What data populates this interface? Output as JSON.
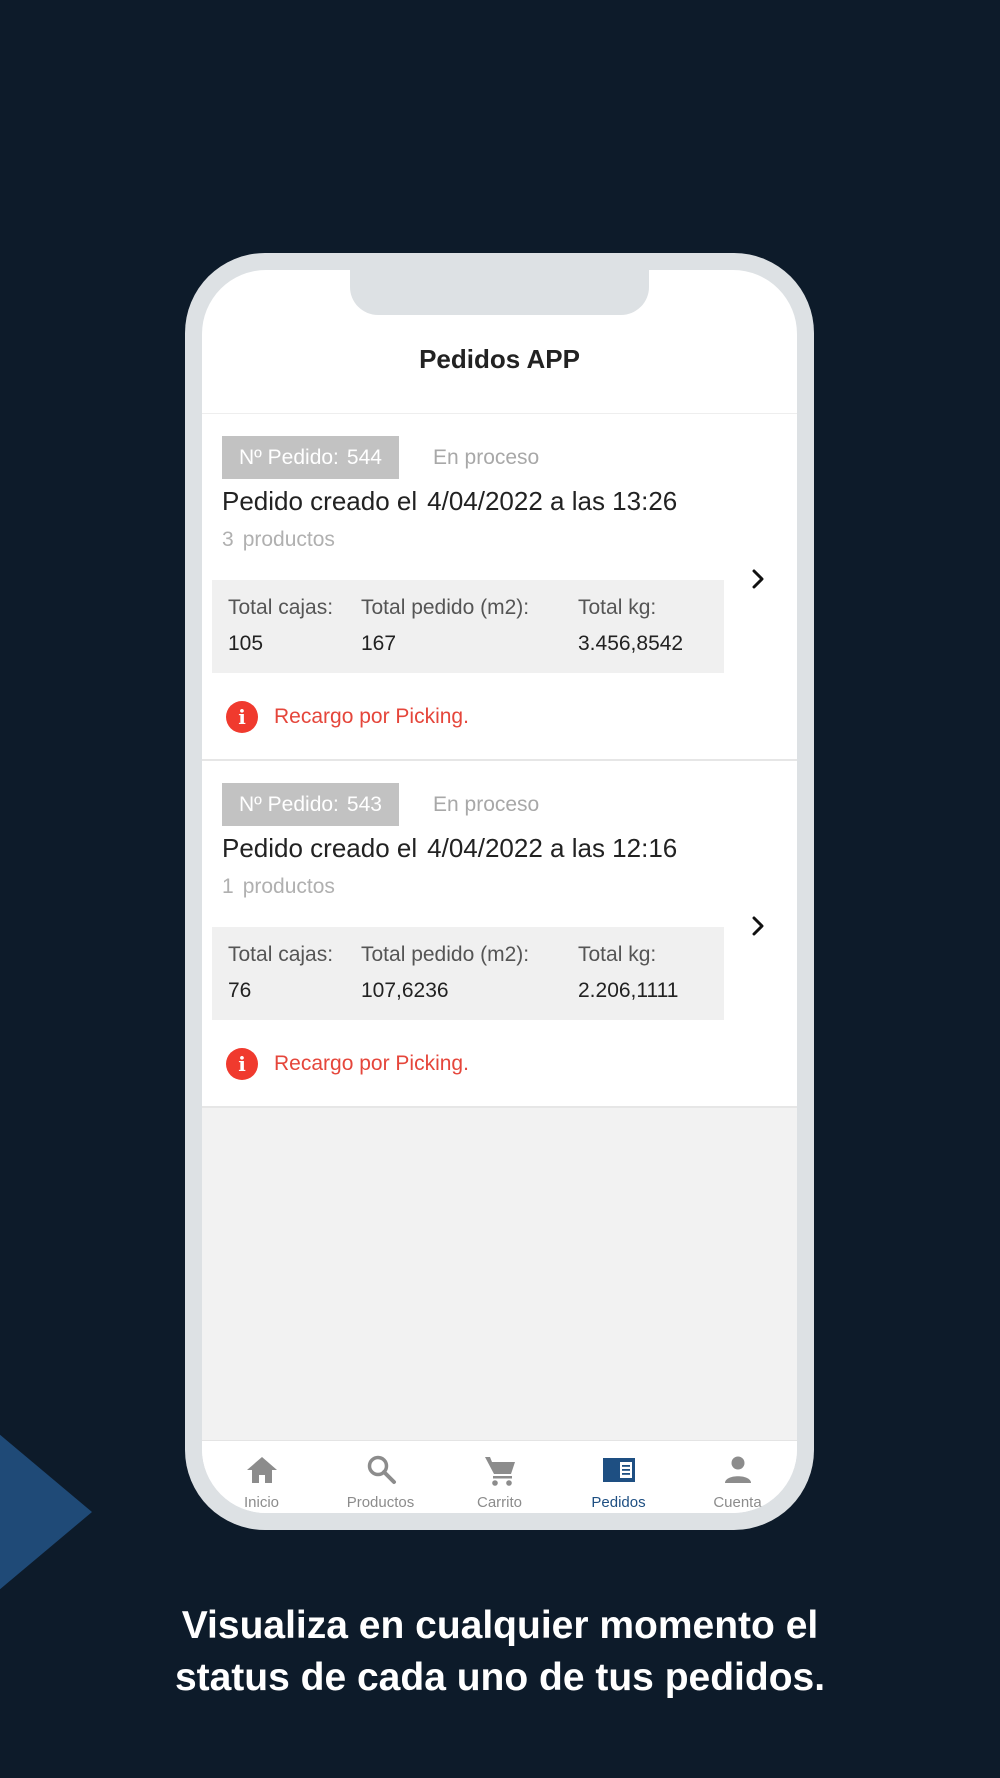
{
  "header": {
    "title": "Pedidos APP"
  },
  "orders": [
    {
      "number_label": "Nº Pedido:",
      "number": "544",
      "status": "En proceso",
      "created_prefix": "Pedido creado el",
      "created_value": "4/04/2022 a las 13:26",
      "products_count": "3",
      "products_label": "productos",
      "totals": {
        "cajas_label": "Total cajas:",
        "cajas_value": "105",
        "pedido_label": "Total pedido (m2):",
        "pedido_value": "167",
        "kg_label": "Total kg:",
        "kg_value": "3.456,8542"
      },
      "surcharge": "Recargo por Picking."
    },
    {
      "number_label": "Nº Pedido:",
      "number": "543",
      "status": "En proceso",
      "created_prefix": "Pedido creado el",
      "created_value": "4/04/2022 a las 12:16",
      "products_count": "1",
      "products_label": "productos",
      "totals": {
        "cajas_label": "Total cajas:",
        "cajas_value": "76",
        "pedido_label": "Total pedido (m2):",
        "pedido_value": "107,6236",
        "kg_label": "Total kg:",
        "kg_value": "2.206,1111"
      },
      "surcharge": "Recargo por Picking."
    }
  ],
  "tabs": [
    {
      "label": "Inicio",
      "icon": "home-icon"
    },
    {
      "label": "Productos",
      "icon": "search-icon"
    },
    {
      "label": "Carrito",
      "icon": "cart-icon"
    },
    {
      "label": "Pedidos",
      "icon": "orders-icon",
      "active": true
    },
    {
      "label": "Cuenta",
      "icon": "user-icon"
    }
  ],
  "caption": {
    "line1": "Visualiza en cualquier momento el",
    "line2": "status de cada uno de tus pedidos."
  },
  "colors": {
    "background": "#0d1b2a",
    "accent": "#1e4f82",
    "alert": "#f03a2e",
    "badge": "#c2c2c2"
  }
}
